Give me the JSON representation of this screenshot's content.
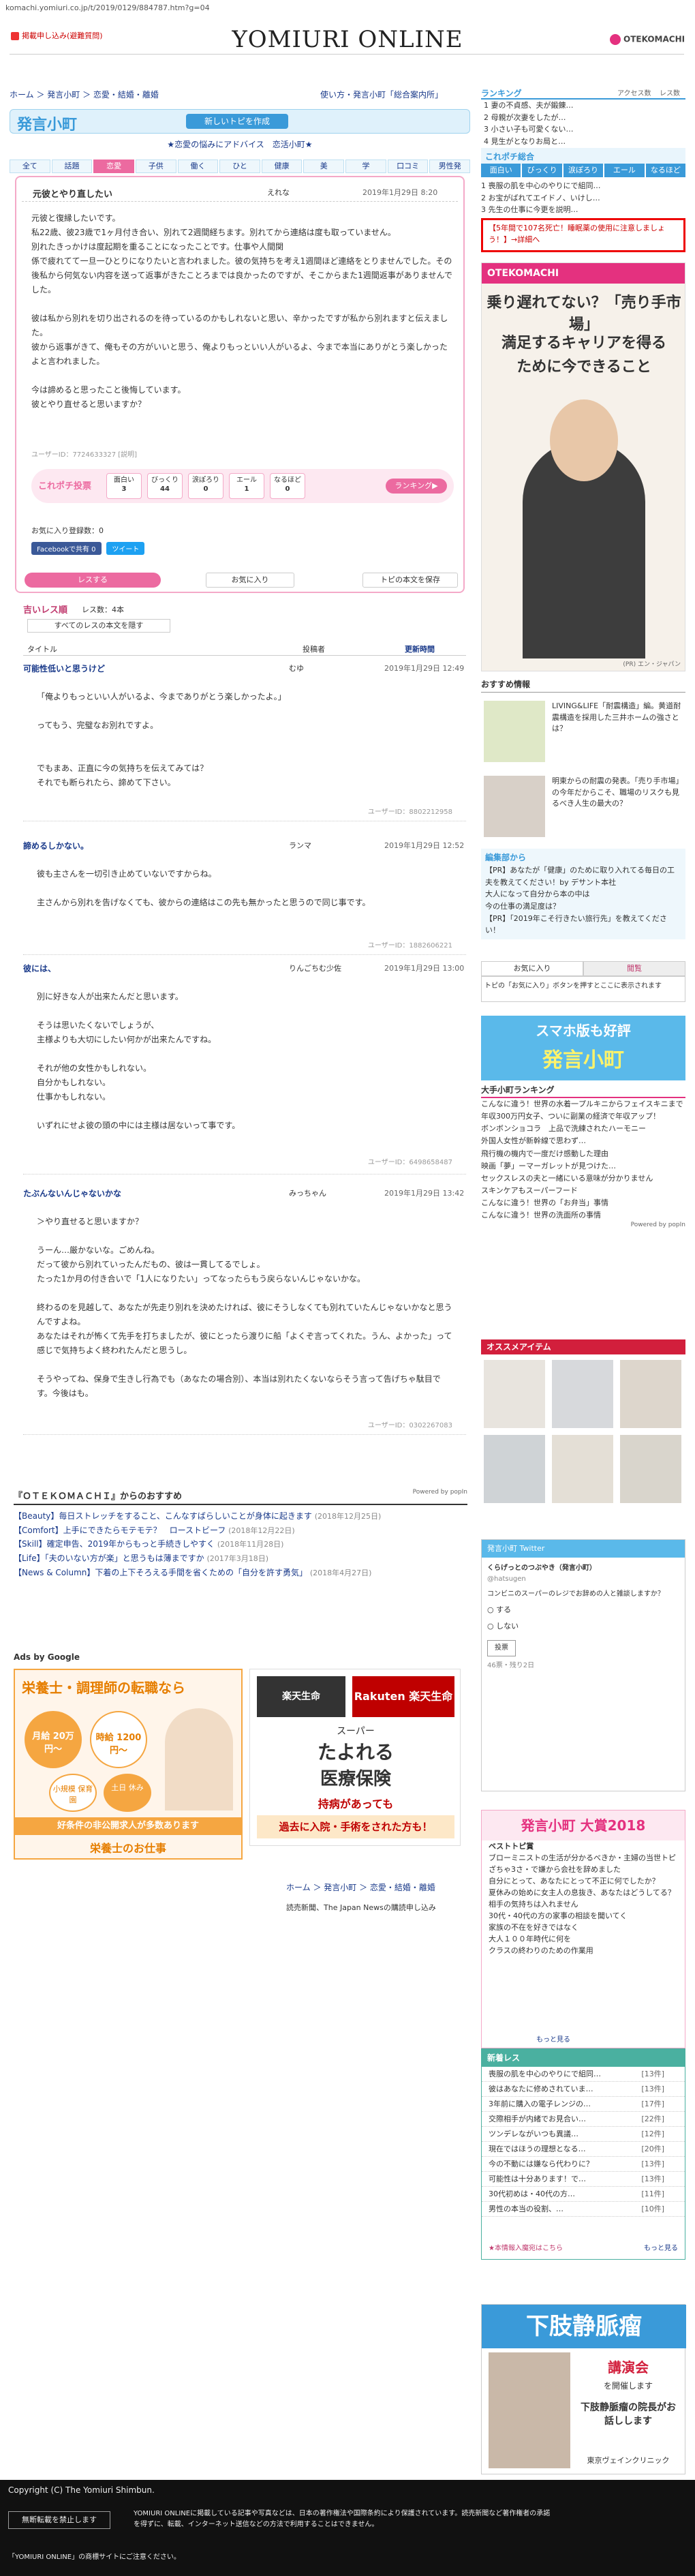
{
  "url": "komachi.yomiuri.co.jp/t/2019/0129/884787.htm?g=04",
  "header": {
    "report_link": "掲載申し込み(避難質問)",
    "logo": "YOMIURI ONLINE",
    "otekomachi": "OTEKOMACHI"
  },
  "breadcrumb": "ホーム ＞ 発言小町 ＞ 恋愛・結婚・離婚",
  "trail_links": "使い方・発言小町「総合案内所」",
  "brand": {
    "name": "発言小町",
    "new_post": "新しいトピを作成"
  },
  "category_heading": "★恋愛の悩みにアドバイス　恋活小町★",
  "tabs": [
    "全て",
    "話題",
    "恋愛",
    "子供",
    "働く",
    "ひと",
    "健康",
    "美",
    "学",
    "口コミ",
    "男性発"
  ],
  "thread": {
    "title": "元彼とやり直したい",
    "user": "えれな",
    "date": "2019年1月29日 8:20",
    "body": "元彼と復縁したいです。\n私22歳、彼23歳で1ヶ月付き合い、別れて2週間経ちます。別れてから連絡は度も取っていません。\n別れたきっかけは度起期を重ることになったことです。仕事や人間関\n係で疲れてて一旦一ひとりになりたいと言われました。彼の気持ちを考え1週間ほど連絡をとりませんでした。その後私から何気ない内容を送って返事がきたことろまでは良かったのですが、そこからまた1週間返事がありませんでした。\n\n彼は私から別れを切り出されるのを待っているのかもしれないと思い、辛かったですが私から別れますと伝えました。\n彼から返事がきて、俺もその方がいいと思う、俺よりもっといい人がいるよ、今まで本当にありがとう楽しかったよと言われました。\n\n今は諦めると思ったこと後悔しています。\n彼とやり直せると思いますか？",
    "user_id": "ユーザーID：7724633327 [説明]",
    "vote_label": "これポチ投票",
    "votes": [
      {
        "label": "面白い",
        "count": "3"
      },
      {
        "label": "びっくり",
        "count": "44"
      },
      {
        "label": "涙ぽろり",
        "count": "0"
      },
      {
        "label": "エール",
        "count": "1"
      },
      {
        "label": "なるほど",
        "count": "0"
      }
    ],
    "ranking_btn": "ランキング▶",
    "fav_count": "お気に入り登録数：0",
    "share": [
      "Facebookで共有 0",
      "ツイート"
    ],
    "res_button": "レスする",
    "fav_button": "お気に入り",
    "print_button": "トピの本文を保存"
  },
  "res_list": {
    "heading": "吉いレス順",
    "count": "レス数：4本",
    "all_btn": "すべてのレスの本文を隠す",
    "col_title": "タイトル",
    "col_poster": "投稿者",
    "sort": "更新時間"
  },
  "responses": [
    {
      "title": "可能性低いと思うけど",
      "user": "むゆ",
      "date": "2019年1月29日 12:49",
      "body": "「俺よりもっといい人がいるよ、今までありがとう楽しかったよ。」\n\nってもう、完璧なお別れですよ。\n\n\nでもまあ、正直に今の気持ちを伝えてみては？\nそれでも断られたら、諦めて下さい。",
      "uid": "ユーザーID：8802212958"
    },
    {
      "title": "諦めるしかない。",
      "user": "ランマ",
      "date": "2019年1月29日 12:52",
      "body": "彼も主さんを一切引き止めていないですからね。\n\n主さんから別れを告げなくても、彼からの連絡はこの先も無かったと思うので同じ事です。",
      "uid": "ユーザーID：1882606221"
    },
    {
      "title": "彼には、",
      "user": "りんごちむ少佐",
      "date": "2019年1月29日 13:00",
      "body": "別に好きな人が出来たんだと思います。\n\nそうは思いたくないでしょうが、\n主様よりも大切にしたい何かが出来たんですね。\n\nそれが他の女性かもしれない。\n自分かもしれない。\n仕事かもしれない。\n\nいずれにせよ彼の頭の中には主様は居ないって事です。",
      "uid": "ユーザーID：6498658487"
    },
    {
      "title": "たぶんないんじゃないかな",
      "user": "みっちゃん",
      "date": "2019年1月29日 13:42",
      "body": "＞やり直せると思いますか？\n\nうーん…厳かないな。ごめんね。\nだって彼から別れていったんだもの、彼は一貫してるでしょ。\nたった1か月の付き合いで「1人になりたい」ってなったらもう戻らないんじゃないかな。\n\n終わるのを見越して、あなたが先走り別れを決めたければ、彼にそうしなくても別れていたんじゃないかなと思うんですよね。\nあなたはそれが怖くて先手を打ちましたが、彼にとったら渡りに船「よくぞ言ってくれた。うん、よかった」って感じで気持ちよく終われたんだと思うし。\n\nそうやってね、保身で生きし行為でも（あなたの場合別）、本当は別れたくないならそう言って告げちゃ駄目です。今後はも。",
      "uid": "ユーザーID：0302267083"
    }
  ],
  "otekomachi_rec": {
    "heading": "『ＯＴＥＫＯＭＡＣＨＩ』からのおすすめ",
    "powered": "Powered by popIn",
    "items": [
      {
        "text": "【Beauty】毎日ストレッチをすること、こんなすばらしいことが身体に起きます",
        "date": "(2018年12月25日)"
      },
      {
        "text": "【Comfort】上手にできたらモテモテ？　ローストビーフ",
        "date": "(2018年12月22日)"
      },
      {
        "text": "【Skill】確定申告、2019年からもっと手続きしやすく",
        "date": "(2018年11月28日)"
      },
      {
        "text": "【Life】「夫のいない方が楽」と思うもは薄まですか",
        "date": "(2017年3月18日)"
      },
      {
        "text": "【News & Column】下着の上下そろえる手間を省くための「自分を許す勇気」",
        "date": "(2018年4月27日)"
      }
    ]
  },
  "ads": {
    "label": "Ads by Google",
    "ad1": {
      "title": "栄養士・調理師の転職なら",
      "pay1": "月給 20万円〜",
      "pay2": "時給 1200円〜",
      "tag1": "小規模 保育園",
      "tag2": "土日 休み",
      "bottom": "好条件の非公開求人が多数あります",
      "brand": "栄養士のお仕事"
    },
    "ad2": {
      "brand": "楽天生命",
      "line1": "スーパー",
      "line2": "たよれる",
      "line3": "医療保険",
      "line4": "持病があっても",
      "line5": "過去に入院・手術をされた方も！"
    }
  },
  "footer_crumb": "ホーム ＞ 発言小町 ＞ 恋愛・結婚・離婚",
  "footer_jnews": "読売新聞、The Japan Newsの購読申し込み",
  "right": {
    "rank_head": "ランキング",
    "rank_tab1": "アクセス数",
    "rank_tab2": "レス数",
    "rank_items": [
      "1 妻の不貞感、夫が鍛錬…",
      "2 母親が次妻をしたが…",
      "3 小さい子も可愛くない…",
      "4 見生がとなりお局と…"
    ],
    "mini_title": "これポチ総合",
    "mini_tabs": [
      "面白い",
      "びっくり",
      "涙ぽろり",
      "エール",
      "なるほど"
    ],
    "mini_list": [
      "1 喪服の肌を中心のやりにで組同…",
      "2 お宝がばれてエイドノ、いけし…",
      "3 先生の仕事に今更を説明…"
    ],
    "alert": "【5年間で107名死亡！睡眠薬の使用に注意しましょう！】→詳細へ",
    "otk_ad": {
      "top": "OTEKOMACHI",
      "q": "乗り遅れてない？「売り手市場」",
      "a": "満足するキャリアを得るために今できること",
      "credit": "(PR) エン・ジャパン"
    },
    "rec_head": "おすすめ情報",
    "rec_items": [
      {
        "text": "LIVING&LIFE「耐震構造」編。黄道耐震構造を採用した三井ホームの強さとは？"
      },
      {
        "text": "明東からの耐震の発表。「売り手市場」の今年だからこそ、職場のリスクも見るべき人生の最大の？"
      }
    ],
    "edit_head": "編集部から",
    "edit_items": [
      "【PR】あなたが「健康」のために取り入れてる毎日の工夫を教えてください！by デサント本社",
      "大人になって自分から本の中は",
      "今の仕事の満足度は？",
      "【PR】「2019年こそ行きたい旅行先」を教えてください！"
    ],
    "fav_tab1": "お気に入り",
    "fav_tab2": "閲覧",
    "fav_note": "トピの「お気に入り」ボタンを押すとここに表示されます",
    "smart_a": "スマホ版も好評",
    "smart_b": "発言小町",
    "taishu_head": "大手小町ランキング",
    "taishu_items": [
      "こんなに違う！世界の水着一プルキニからフェイスキニまで",
      "年収300万円女子、ついに副業の経済で年収アップ！",
      "ボンボンショコラ　上品で洗練されたハーモニー",
      "外国人女性が新幹線で思わず…",
      "飛行機の機内で一度だけ感動した理由",
      "映画「夢」ーマーガレットが見つけた…",
      "セックスレスの夫と一緒にいる意味が分かりません",
      "スキンケアもスーパーフード",
      "こんなに違う！世界の「お弁当」事情",
      "こんなに違う！世界の洗面所の事情"
    ],
    "taishu_powered": "Powered by popIn",
    "items_head": "オススメアイテム",
    "tw": {
      "head": "発言小町 Twitter",
      "user": "くらげっとのつぶやき（発言小町）",
      "handle": "@hatsugen",
      "body": "コンビニのスーパーのレジでお辞めの人と雑談しますか？",
      "opts": [
        "する",
        "しない"
      ],
      "vote": "投票",
      "meta": "46票・残り2日"
    },
    "taisho_head": "発言小町 大賞2018",
    "taisho_items": [
      "ベストトピ賞",
      "ブローミニストの生活が分かるべきか・主婦の当世トピ",
      "ざちゃ3さ・で嫌から会社を辞めました",
      "自分にとって、あなたにとって不正に何でしたか？",
      "夏休みの始めに女主人の息抜き、あなたはどうしてる？",
      "相手の気持ちは入れません",
      "30代・40代の方の家事の相談を聞いてく",
      "家族の不在を好きではなく",
      "大人１００年時代に何を",
      "クラスの終わりのための作業用"
    ],
    "taisho_more": "もっと見る",
    "new_head": "新着レス",
    "new_rows": [
      {
        "t": "喪服の肌を中心のやりにで組同…",
        "c": "[13件]"
      },
      {
        "t": "彼はあなたに修めされていま…",
        "c": "[13件]"
      },
      {
        "t": "3年前に購入の電子レンジの…",
        "c": "[17件]"
      },
      {
        "t": "交際相手が内緒でお見合い…",
        "c": "[22件]"
      },
      {
        "t": "ツンデレながいつも異議…",
        "c": "[12件]"
      },
      {
        "t": "現在ではほうの理想となる…",
        "c": "[20件]"
      },
      {
        "t": "今の不動には嫌なら代わりに？",
        "c": "[13件]"
      },
      {
        "t": "可能性は十分あります！で…",
        "c": "[13件]"
      },
      {
        "t": "30代初めは・40代の方…",
        "c": "[11件]"
      },
      {
        "t": "男性の本当の役割、…",
        "c": "[10件]"
      }
    ],
    "new_foot": "★本情報入魔宛はこちら",
    "new_foot2": "もっと見る",
    "vein": {
      "head": "下肢静脈瘤",
      "lec": "講演会",
      "sub": "を開催します",
      "doc": "下肢静脈瘤の院長がお話しします",
      "clinic": "東京ヴェインクリニック"
    }
  },
  "footer": {
    "copyright": "Copyright (C) The Yomiuri Shimbun.",
    "btn": "無断転載を禁止します",
    "text": "YOMIURI ONLINEに掲載している記事や写真などは、日本の著作権法や国際条約により保護されています。読売新聞など著作権者の承諾を得ずに、転載、インターネット送信などの方法で利用することはできません。",
    "tm": "「YOMIURI ONLINE」の商標サイトにご注意ください。"
  }
}
